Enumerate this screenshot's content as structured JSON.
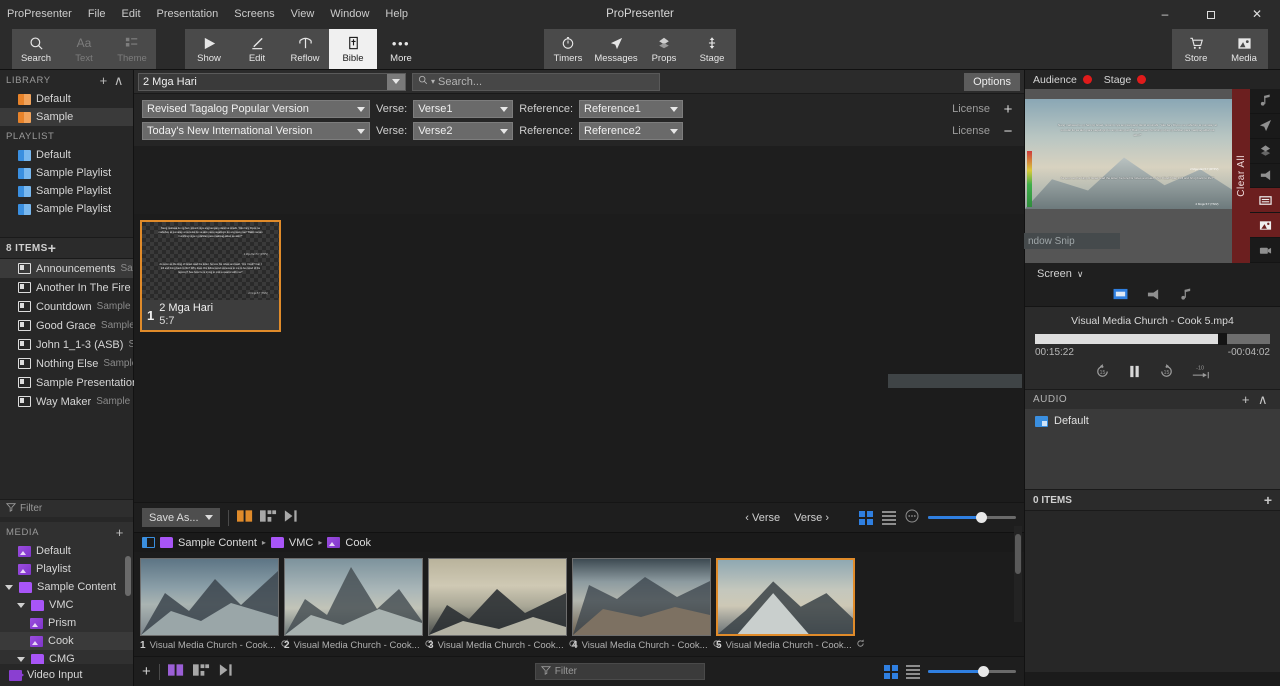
{
  "menubar": {
    "items": [
      "ProPresenter",
      "File",
      "Edit",
      "Presentation",
      "Screens",
      "View",
      "Window",
      "Help"
    ]
  },
  "window": {
    "title": "ProPresenter",
    "minimize": "–",
    "maximize": "❐",
    "close": "✕"
  },
  "toolbar": {
    "left": [
      {
        "label": "Search",
        "icon": "search-icon",
        "state": "normal"
      },
      {
        "label": "Text",
        "icon": "text-icon",
        "state": "dim"
      },
      {
        "label": "Theme",
        "icon": "theme-icon",
        "state": "dim"
      }
    ],
    "center": [
      {
        "label": "Show",
        "icon": "play-icon",
        "state": "normal"
      },
      {
        "label": "Edit",
        "icon": "pencil-icon",
        "state": "normal"
      },
      {
        "label": "Reflow",
        "icon": "reflow-icon",
        "state": "normal"
      },
      {
        "label": "Bible",
        "icon": "bible-icon",
        "state": "active"
      },
      {
        "label": "More",
        "icon": "more-icon",
        "state": "plain"
      }
    ],
    "utility": [
      {
        "label": "Timers",
        "icon": "timer-icon"
      },
      {
        "label": "Messages",
        "icon": "message-icon"
      },
      {
        "label": "Props",
        "icon": "props-icon"
      },
      {
        "label": "Stage",
        "icon": "stage-icon"
      }
    ],
    "right": [
      {
        "label": "Store",
        "icon": "cart-icon"
      },
      {
        "label": "Media",
        "icon": "media-icon"
      }
    ]
  },
  "sidebar": {
    "library": {
      "title": "LIBRARY",
      "add": "+",
      "collapse": "∧",
      "items": [
        {
          "label": "Default",
          "selected": false
        },
        {
          "label": "Sample",
          "selected": true
        }
      ]
    },
    "playlist": {
      "title": "PLAYLIST",
      "items": [
        {
          "label": "Default"
        },
        {
          "label": "Sample Playlist"
        },
        {
          "label": "Sample Playlist"
        },
        {
          "label": "Sample Playlist"
        }
      ]
    },
    "items_header": {
      "title": "8 ITEMS",
      "add": "+"
    },
    "items": [
      {
        "label": "Announcements",
        "sub": "Sa...",
        "selected": true
      },
      {
        "label": "Another In The Fire",
        "sub": "...",
        "selected": false
      },
      {
        "label": "Countdown",
        "sub": "Sample",
        "selected": false
      },
      {
        "label": "Good Grace",
        "sub": "Sample",
        "selected": false
      },
      {
        "label": "John 1_1-3 (ASB)",
        "sub": "S...",
        "selected": false
      },
      {
        "label": "Nothing Else",
        "sub": "Sample",
        "selected": false
      },
      {
        "label": "Sample Presentation",
        "sub": "",
        "selected": false
      },
      {
        "label": "Way Maker",
        "sub": "Sample",
        "selected": false
      }
    ],
    "filter": {
      "label": "Filter",
      "icon": "filter-icon"
    },
    "media": {
      "title": "MEDIA",
      "add": "+",
      "items": [
        {
          "label": "Default",
          "kind": "media",
          "indent": 0,
          "twisty": false,
          "selected": false
        },
        {
          "label": "Playlist",
          "kind": "media",
          "indent": 0,
          "twisty": false,
          "selected": false
        },
        {
          "label": "Sample Content",
          "kind": "folder",
          "indent": 0,
          "twisty": true,
          "selected": false
        },
        {
          "label": "VMC",
          "kind": "folder",
          "indent": 1,
          "twisty": true,
          "selected": false
        },
        {
          "label": "Prism",
          "kind": "media",
          "indent": 2,
          "twisty": false,
          "selected": false
        },
        {
          "label": "Cook",
          "kind": "media",
          "indent": 2,
          "twisty": false,
          "selected": true
        },
        {
          "label": "CMG",
          "kind": "folder",
          "indent": 1,
          "twisty": true,
          "selected": false
        }
      ],
      "video_input": {
        "label": "Video Input",
        "icon": "video-input-icon"
      }
    }
  },
  "bible": {
    "reference_field": {
      "value": "2 Mga Hari",
      "caret": "▾"
    },
    "search": {
      "placeholder": "Search...",
      "icon": "search-icon"
    },
    "options_button": "Options",
    "translations": [
      {
        "version": "Revised Tagalog Popular Version",
        "verse_label": "Verse:",
        "verse_value": "Verse1",
        "reference_label": "Reference:",
        "reference_value": "Reference1",
        "license": "License",
        "action": "+"
      },
      {
        "version": "Today's New International Version",
        "verse_label": "Verse:",
        "verse_value": "Verse2",
        "reference_label": "Reference:",
        "reference_value": "Reference2",
        "license": "License",
        "action": "−"
      }
    ],
    "slide": {
      "number": "1",
      "title": "2 Mga Hari",
      "subtitle": "5:7",
      "body_top": "Nang mabasa ito ng hari, pinunit niya ang kanyang damit at sinabi, \"Ako ba'y Diyos na mabuhay at pumatay at sumulat ito sa akin para pagalingin ko ang isang tao? Bakit naman humihingi siya ng dahilan para makipag-alitan sa akin?\"",
      "ref_top": "2 Mga Hari 5:7 (RTPV)",
      "body_bottom": "As soon as the king of Israel read the letter, he tore his robes and said, \"Am I God? Can I kill and bring back to life? Why does this fellow send someone to me to be cured of his leprosy? See how he is trying to pick a quarrel with me!\"",
      "ref_bottom": "2 Kings 5:7 (TNIV)"
    },
    "window_snip": ""
  },
  "center_toolbar": {
    "save_as": "Save As...",
    "save_caret": "▾",
    "prev_verse": "Verse",
    "next_verse": "Verse",
    "prev_caret": "‹",
    "next_caret": "›",
    "zoom_percent": 60
  },
  "breadcrumb": {
    "panel_icon": "panel-toggle-icon",
    "path": [
      "Sample Content",
      "VMC",
      "Cook"
    ],
    "separator": "▸"
  },
  "media_grid": {
    "items": [
      {
        "number": "1",
        "label": "Visual Media Church - Cook...",
        "selected": false,
        "sky": "#7e9ab0",
        "rock": "#4d5660"
      },
      {
        "number": "2",
        "label": "Visual Media Church - Cook...",
        "selected": false,
        "sky": "#93a7b2",
        "rock": "#434c52"
      },
      {
        "number": "3",
        "label": "Visual Media Church - Cook...",
        "selected": false,
        "sky": "#b5ad96",
        "rock": "#2f3336"
      },
      {
        "number": "4",
        "label": "Visual Media Church - Cook...",
        "selected": false,
        "sky": "#6f8694",
        "rock": "#5c5144"
      },
      {
        "number": "5",
        "label": "Visual Media Church - Cook...",
        "selected": true,
        "sky": "#a9b7bd",
        "rock": "#3d4549"
      }
    ],
    "loop_icon": "loop-icon"
  },
  "bottom_bar": {
    "add": "+",
    "filter_placeholder": "Filter",
    "filter_icon": "filter-icon",
    "zoom_percent": 62
  },
  "right_panel": {
    "audience": {
      "label": "Audience",
      "status_color": "#e01b1b"
    },
    "stage": {
      "label": "Stage",
      "status_color": "#e01b1b"
    },
    "clear_all": "Clear All",
    "rail_icons": [
      {
        "name": "music-icon",
        "active": false
      },
      {
        "name": "send-icon",
        "active": false
      },
      {
        "name": "props-icon",
        "active": false
      },
      {
        "name": "announce-icon",
        "active": false
      },
      {
        "name": "slide-icon",
        "active": true
      },
      {
        "name": "image-icon",
        "active": true
      },
      {
        "name": "video-icon",
        "active": false
      }
    ],
    "preview": {
      "text_top": "Nang mabasa ito ng hari ng Israel, pinunit niya ang kanyang damit at sinabi, \"Ako ba'y Diyos na mabuhay at pumatay at sumulat ito sa akin para pagalingin ko ang isang tao? Bakit naman humihingi siya ng dahilan para makipag-alitan sa akin?\"",
      "ref_top": "2 Mga Hari 5:7 (RTPV)",
      "text_bottom": "As soon as the king of Israel read the letter, he tore his robes and said, \"Am I God? Can I kill and bring back to life?\"",
      "ref_bottom": "2 Kings 5:7 (TNIV)",
      "snip_label": "ndow Snip"
    },
    "screen": {
      "label": "Screen",
      "caret": "∨"
    },
    "tabs": [
      {
        "name": "screen-tab-icon",
        "active": true
      },
      {
        "name": "announce-tab-icon",
        "active": false
      },
      {
        "name": "audio-tab-icon",
        "active": false
      }
    ],
    "player": {
      "title": "Visual Media Church - Cook 5.mp4",
      "elapsed": "00:15:22",
      "remaining": "-00:04:02",
      "progress_percent": 79,
      "controls": [
        {
          "name": "rewind-15-icon",
          "label": "15"
        },
        {
          "name": "pause-icon",
          "label": ""
        },
        {
          "name": "forward-15-icon",
          "label": "15"
        },
        {
          "name": "jump-minus-10-icon",
          "label": "-10"
        }
      ]
    },
    "audio": {
      "title": "AUDIO",
      "add": "+",
      "collapse": "∧",
      "items": [
        {
          "label": "Default"
        }
      ]
    },
    "items": {
      "title": "0 ITEMS",
      "add": "+"
    }
  }
}
